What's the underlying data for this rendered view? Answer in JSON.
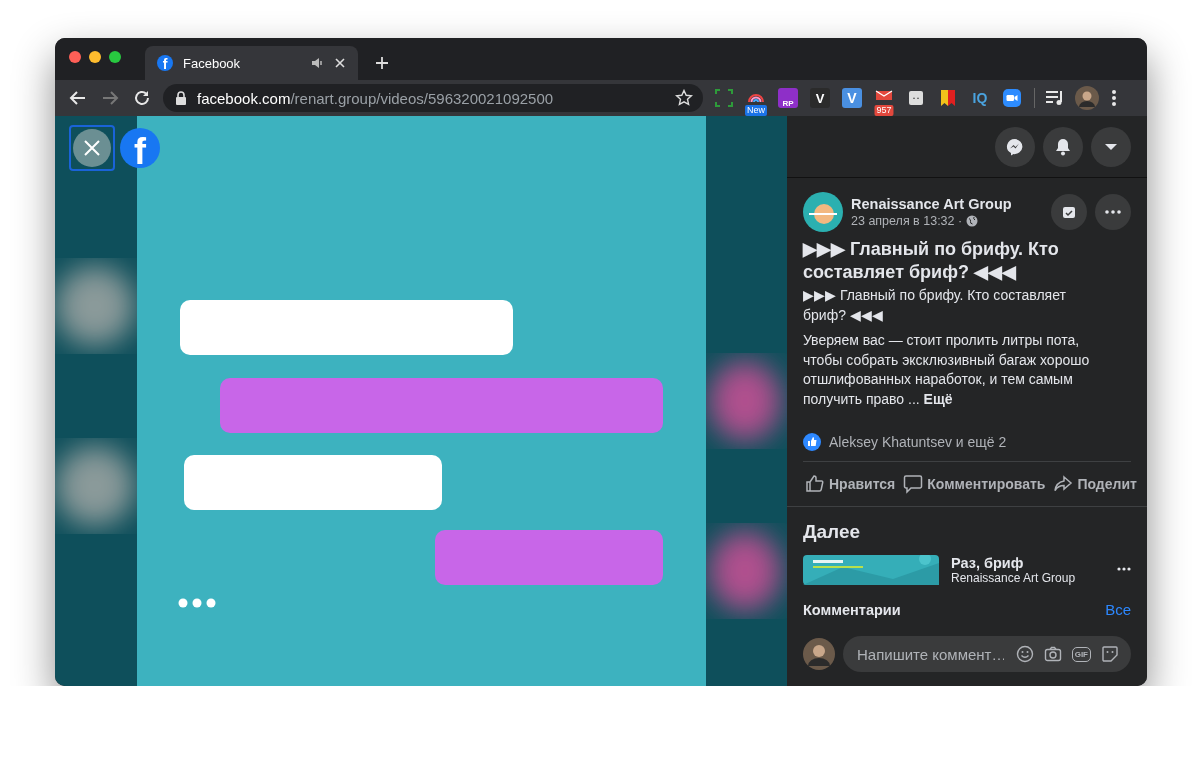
{
  "tabs": [
    {
      "title": "Facebook",
      "favicon": "f",
      "selected": true,
      "audio": true
    }
  ],
  "toolbar": {
    "back_disabled": false,
    "forward_disabled": true,
    "url_host": "facebook.com",
    "url_path": "/renart.group/videos/596320021092500"
  },
  "extensions": [
    {
      "kind": "frame"
    },
    {
      "kind": "rainbow",
      "badge": "New"
    },
    {
      "kind": "rp",
      "label": "RP"
    },
    {
      "kind": "letter",
      "label": "V"
    },
    {
      "kind": "tile",
      "label": "V"
    },
    {
      "kind": "mail",
      "badge": "957"
    },
    {
      "kind": "box"
    },
    {
      "kind": "flag"
    },
    {
      "kind": "text",
      "label": "IQ"
    },
    {
      "kind": "camera"
    }
  ],
  "viewer": {
    "logo": "f"
  },
  "post": {
    "author": "Renaissance Art Group",
    "time": "23 апреля в 13:32 ·",
    "title": "▶▶▶ Главный по брифу. Кто составляет бриф? ◀◀◀",
    "subtitle": "▶▶▶ Главный по брифу. Кто составляет бриф? ◀◀◀",
    "body": "Уверяем вас — стоит пролить литры пота, чтобы собрать эксклюзивный багаж хорошо отшлифованных наработок, и тем самым получить право ...",
    "more": "Ещё",
    "reactions": "Aleksey Khatuntsev и ещё 2",
    "actions": [
      {
        "kind": "like",
        "label": "Нравится"
      },
      {
        "kind": "comment",
        "label": "Комментировать"
      },
      {
        "kind": "share",
        "label": "Поделит"
      }
    ]
  },
  "next": {
    "heading": "Далее",
    "items": [
      {
        "kind": "picture",
        "title": "Раз, бриф",
        "channel": "Renaissance Art Group"
      }
    ]
  },
  "comments": {
    "heading": "Комментарии",
    "all": "Все",
    "placeholder": "Напишите коммент…",
    "tools": [
      {
        "kind": "emoji"
      },
      {
        "kind": "camera"
      },
      {
        "kind": "gif",
        "label": "GIF"
      },
      {
        "kind": "sticker"
      }
    ]
  }
}
